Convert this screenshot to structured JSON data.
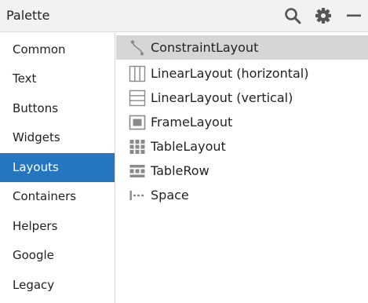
{
  "panel": {
    "title": "Palette",
    "search_icon": "search-icon",
    "settings_icon": "gear-icon",
    "minimize_icon": "minimize-icon"
  },
  "categories": [
    {
      "label": "Common"
    },
    {
      "label": "Text"
    },
    {
      "label": "Buttons"
    },
    {
      "label": "Widgets"
    },
    {
      "label": "Layouts",
      "selected": true
    },
    {
      "label": "Containers"
    },
    {
      "label": "Helpers"
    },
    {
      "label": "Google"
    },
    {
      "label": "Legacy"
    }
  ],
  "items": [
    {
      "label": "ConstraintLayout",
      "icon": "constraint-layout-icon",
      "selected": true
    },
    {
      "label": "LinearLayout (horizontal)",
      "icon": "linear-horizontal-icon"
    },
    {
      "label": "LinearLayout (vertical)",
      "icon": "linear-vertical-icon"
    },
    {
      "label": "FrameLayout",
      "icon": "frame-layout-icon"
    },
    {
      "label": "TableLayout",
      "icon": "table-layout-icon"
    },
    {
      "label": "TableRow",
      "icon": "table-row-icon"
    },
    {
      "label": "Space",
      "icon": "space-icon"
    }
  ],
  "colors": {
    "accent": "#2675bf",
    "selected_item_bg": "#d6d6d6",
    "header_bg": "#f2f2f2",
    "icon_gray": "#8a8a8a"
  }
}
